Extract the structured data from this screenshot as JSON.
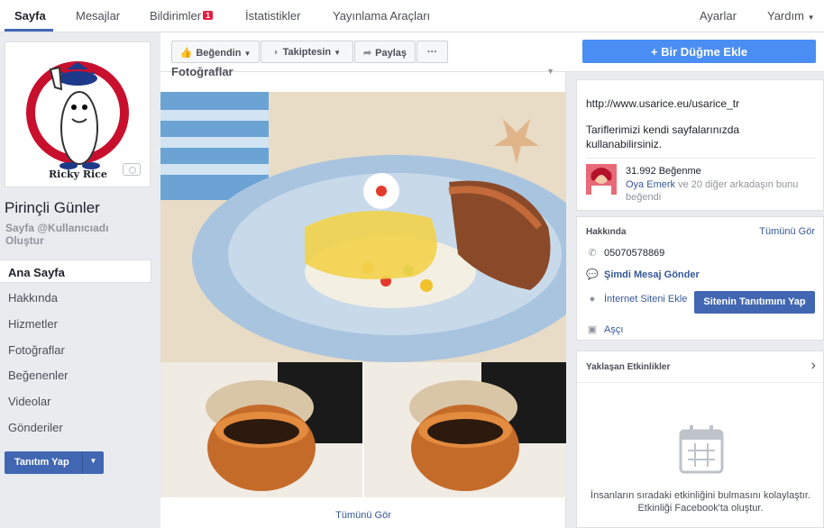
{
  "topnav": {
    "tabs": [
      {
        "label": "Sayfa"
      },
      {
        "label": "Mesajlar"
      },
      {
        "label": "Bildirimler",
        "badge": "1"
      },
      {
        "label": "İstatistikler"
      },
      {
        "label": "Yayınlama Araçları"
      }
    ],
    "settings": "Ayarlar",
    "help": "Yardım"
  },
  "profile": {
    "logo_text": "Ricky Rice",
    "name": "Pirinçli Günler",
    "username": "Sayfa @Kullanıcıadı Oluştur"
  },
  "sidebar": {
    "items": [
      {
        "label": "Ana Sayfa"
      },
      {
        "label": "Hakkında"
      },
      {
        "label": "Hizmetler"
      },
      {
        "label": "Fotoğraflar"
      },
      {
        "label": "Beğenenler"
      },
      {
        "label": "Videolar"
      },
      {
        "label": "Gönderiler"
      }
    ],
    "promote": "Tanıtım Yap"
  },
  "actions": {
    "like": "Beğendin",
    "follow": "Takiptesin",
    "share": "Paylaş",
    "more": "···",
    "add_button": "Bir Düğme Ekle"
  },
  "photos": {
    "title": "Fotoğraflar",
    "see_all": "Tümünü Gör"
  },
  "info": {
    "url": "http://www.usarice.eu/usarice_tr",
    "description": "Tariflerimizi kendi sayfalarınızda kullanabilirsiniz.",
    "likes_count": "31.992 Beğenme",
    "friend_name": "Oya Emerk",
    "friends_text": "ve 20 diğer arkadaşın bunu beğendi"
  },
  "about": {
    "title": "Hakkında",
    "see_all": "Tümünü Gör",
    "phone": "05070578869",
    "message": "Şimdi Mesaj Gönder",
    "website": "İnternet Siteni Ekle",
    "promote_site": "Sitenin Tanıtımını Yap",
    "category": "Aşçı"
  },
  "events": {
    "title": "Yaklaşan Etkinlikler",
    "empty_text": "İnsanların sıradaki etkinliğini bulmasını kolaylaştır. Etkinliği Facebook'ta oluştur."
  },
  "colors": {
    "primary": "#4267b2",
    "accent": "#4a8ef3",
    "badge": "#e41e3f"
  }
}
